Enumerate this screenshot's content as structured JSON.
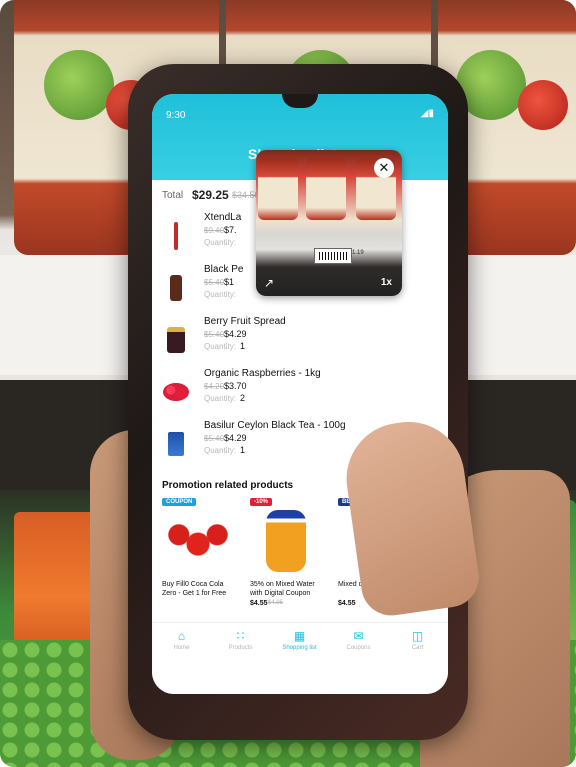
{
  "status": {
    "time": "9:30"
  },
  "app": {
    "title": "Shopping list"
  },
  "summary": {
    "total_label": "Total",
    "total_value": "$29.25",
    "total_old": "$34.50"
  },
  "items": [
    {
      "name": "XtendLa",
      "old_price": "$9.40",
      "price": "$7.",
      "qty_label": "Quantity:",
      "qty": ""
    },
    {
      "name": "Black Pe",
      "old_price": "$5.40",
      "price": "$1",
      "qty_label": "Quantity:",
      "qty": ""
    },
    {
      "name": "Berry Fruit Spread",
      "old_price": "$5.40",
      "price": "$4.29",
      "qty_label": "Quantity:",
      "qty": "1"
    },
    {
      "name": "Organic Raspberries - 1kg",
      "old_price": "$4.20",
      "price": "$3.70",
      "qty_label": "Quantity:",
      "qty": "2"
    },
    {
      "name": "Basilur Ceylon Black Tea - 100g",
      "old_price": "$5.40",
      "price": "$4.29",
      "qty_label": "Quantity:",
      "qty": "1"
    }
  ],
  "camera": {
    "zoom": "1x",
    "shelf_price": "1.19"
  },
  "promo": {
    "title": "Promotion related products",
    "cards": [
      {
        "badge": "COUPON",
        "name": "Buy Fill0 Coca Cola Zero - Get 1 for Free",
        "price": "",
        "old_price": ""
      },
      {
        "badge": "-10%",
        "name": "35% on Mixed Water with Digital Coupon",
        "price": "$4.55",
        "old_price": "$4.95"
      },
      {
        "badge": "BESTSELLER",
        "name": "Mixed drawer - 0.67l",
        "price": "$4.55",
        "old_price": ""
      }
    ]
  },
  "nav": [
    {
      "label": "Home",
      "icon": "home-icon"
    },
    {
      "label": "Products",
      "icon": "grid-icon"
    },
    {
      "label": "Shopping list",
      "icon": "list-icon"
    },
    {
      "label": "Coupons",
      "icon": "coupon-icon"
    },
    {
      "label": "Cart",
      "icon": "cart-icon"
    }
  ],
  "colors": {
    "accent": "#1fc0da",
    "text": "#111111",
    "muted": "#b5b5b5"
  }
}
